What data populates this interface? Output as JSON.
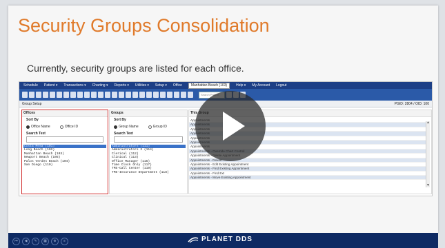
{
  "slide": {
    "title": "Security Groups Consolidation",
    "subtitle": "Currently, security groups are listed for each office."
  },
  "app": {
    "menu": [
      "Schedule",
      "Patient ▾",
      "Transactions ▾",
      "Charting ▾",
      "Reports ▾",
      "Utilities ▾",
      "Setup ▾",
      "Office",
      "Help ▾",
      "My Account",
      "Logout"
    ],
    "office_value": "Manhattan Beach (103)",
    "toolbar_search_placeholder": "Search Patient",
    "infobar_left": "Group Setup",
    "infobar_right": "PGID: 2804 / OID: 100",
    "offices": {
      "header": "Offices",
      "sort_by": "Sort By",
      "radio_name": "Office Name",
      "radio_id": "Office ID",
      "search_text": "Search Text",
      "items": [
        "Costa Mesa (101)",
        "Long Beach (102)",
        "Manhattan Beach (103)",
        "Newport Beach (105)",
        "Palos Verdes Beach (104)",
        "San Diego (110)"
      ]
    },
    "groups": {
      "header": "Groups",
      "sort_by": "Sort By",
      "radio_name": "Group Name",
      "radio_id": "Group ID",
      "search_text": "Search Text",
      "items": [
        "Administrators (111)",
        "Administrators 2 (114)",
        "Clerical (112)",
        "Clinical (113)",
        "Office Manager (115)",
        "Time Clock Only (117)",
        "TMS-Call Center (119)",
        "TMS-Insurance Department (118)"
      ]
    },
    "this_group": {
      "header": "This Group",
      "items": [
        "Appointments",
        "Appointments",
        "Appointments",
        "Appointments",
        "Appointments",
        "Appointments",
        "Appointments",
        "Appointments - Override Chart Control",
        "Appointments - Delete Appointment",
        "Appointments - Delete",
        "Appointments - Edit Existing Appointment",
        "Appointments - Find Existing Appointment",
        "Appointments - Find Ext",
        "Appointments - Move Existing Appointment"
      ]
    }
  },
  "footer": {
    "logo_text": "PLANET DDS"
  }
}
